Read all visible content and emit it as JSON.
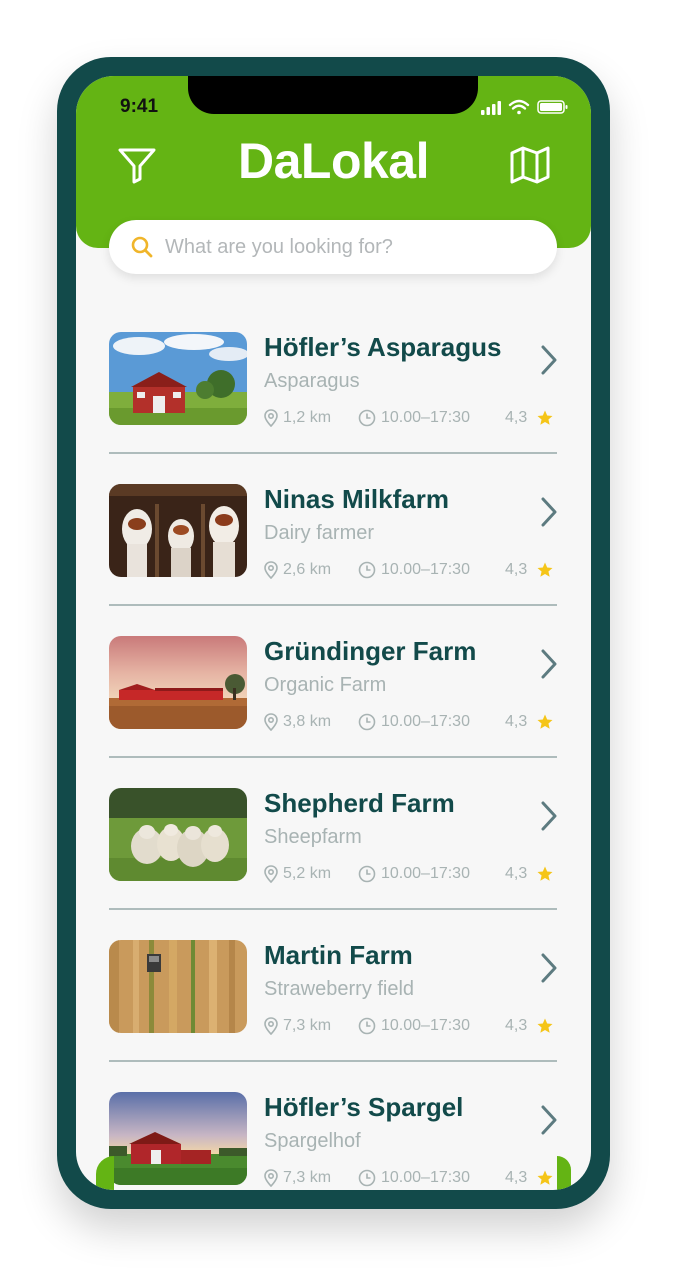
{
  "status_bar": {
    "time": "9:41"
  },
  "header": {
    "title": "DaLokal",
    "filter_icon": "filter-icon",
    "map_icon": "map-icon"
  },
  "search": {
    "placeholder": "What are you looking for?"
  },
  "colors": {
    "brand_green": "#64b414",
    "dark_teal": "#124a4a",
    "star": "#f5c518"
  },
  "farms": [
    {
      "name": "Höfler’s Asparagus",
      "category": "Asparagus",
      "distance": "1,2 km",
      "hours": "10.00–17:30",
      "rating": "4,3"
    },
    {
      "name": "Ninas Milkfarm",
      "category": "Dairy farmer",
      "distance": "2,6 km",
      "hours": "10.00–17:30",
      "rating": "4,3"
    },
    {
      "name": "Gründinger Farm",
      "category": "Organic Farm",
      "distance": "3,8 km",
      "hours": "10.00–17:30",
      "rating": "4,3"
    },
    {
      "name": "Shepherd Farm",
      "category": "Sheepfarm",
      "distance": "5,2 km",
      "hours": "10.00–17:30",
      "rating": "4,3"
    },
    {
      "name": "Martin Farm",
      "category": "Straweberry field",
      "distance": "7,3 km",
      "hours": "10.00–17:30",
      "rating": "4,3"
    },
    {
      "name": "Höfler’s Spargel",
      "category": "Spargelhof",
      "distance": "7,3 km",
      "hours": "10.00–17:30",
      "rating": "4,3"
    }
  ]
}
